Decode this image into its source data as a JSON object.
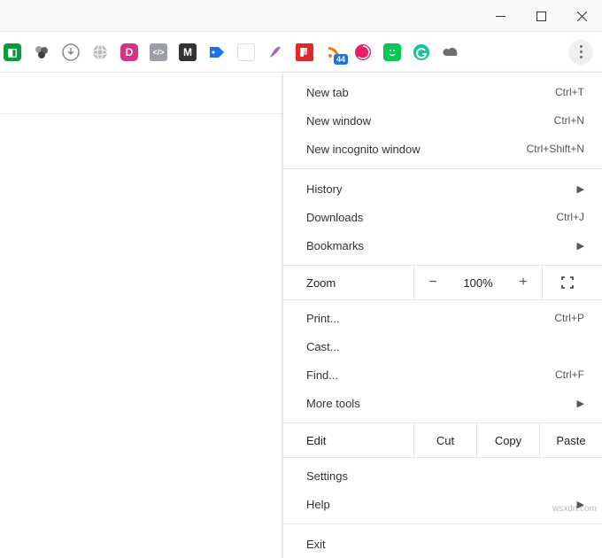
{
  "window_controls": {
    "min": "minimize",
    "max": "maximize",
    "close": "close"
  },
  "extensions": [
    {
      "name": "idm",
      "bg": "#0a9b3e",
      "glyph": "◧"
    },
    {
      "name": "spheres",
      "bg": "transparent"
    },
    {
      "name": "download",
      "bg": "transparent"
    },
    {
      "name": "globe",
      "bg": "transparent"
    },
    {
      "name": "d",
      "bg": "#d63384",
      "glyph": "D"
    },
    {
      "name": "code",
      "bg": "#9aa0a6",
      "glyph": "</>"
    },
    {
      "name": "m",
      "bg": "#333",
      "glyph": "M"
    },
    {
      "name": "tag",
      "bg": "#1a73e8"
    },
    {
      "name": "blank",
      "bg": "#fff"
    },
    {
      "name": "feather",
      "bg": "transparent"
    },
    {
      "name": "flipboard",
      "bg": "#e12828",
      "glyph": "F"
    },
    {
      "name": "rss",
      "bg": "transparent",
      "badge": "44"
    },
    {
      "name": "spiral",
      "bg": "#e91e63"
    },
    {
      "name": "smile",
      "bg": "#00c853"
    },
    {
      "name": "grammarly",
      "bg": "#15c39a",
      "glyph": "G"
    },
    {
      "name": "cloud",
      "bg": "#6d6d6d"
    }
  ],
  "menu": {
    "group1": [
      {
        "label": "New tab",
        "shortcut": "Ctrl+T"
      },
      {
        "label": "New window",
        "shortcut": "Ctrl+N"
      },
      {
        "label": "New incognito window",
        "shortcut": "Ctrl+Shift+N"
      }
    ],
    "group2": [
      {
        "label": "History",
        "submenu": true
      },
      {
        "label": "Downloads",
        "shortcut": "Ctrl+J"
      },
      {
        "label": "Bookmarks",
        "submenu": true
      }
    ],
    "zoom": {
      "label": "Zoom",
      "value": "100%",
      "minus": "−",
      "plus": "+"
    },
    "group3": [
      {
        "label": "Print...",
        "shortcut": "Ctrl+P"
      },
      {
        "label": "Cast..."
      },
      {
        "label": "Find...",
        "shortcut": "Ctrl+F"
      },
      {
        "label": "More tools",
        "submenu": true
      }
    ],
    "edit": {
      "label": "Edit",
      "cut": "Cut",
      "copy": "Copy",
      "paste": "Paste"
    },
    "group4": [
      {
        "label": "Settings"
      },
      {
        "label": "Help",
        "submenu": true
      }
    ],
    "group5": [
      {
        "label": "Exit"
      }
    ]
  },
  "watermark": "wsxdn.com"
}
